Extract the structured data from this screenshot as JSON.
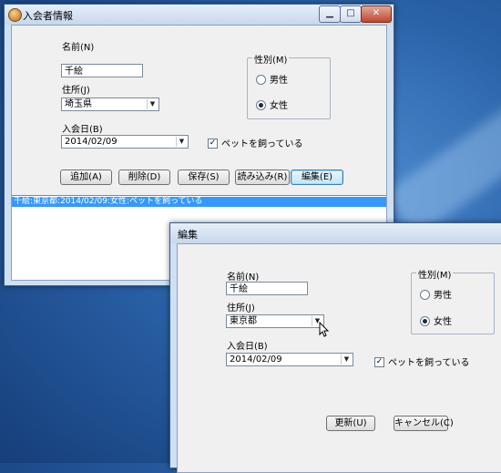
{
  "main_window": {
    "title": "入会者情報",
    "controls": {
      "minimize": "▁",
      "maximize": "□",
      "close": "✕"
    },
    "name_label": "名前(N)",
    "name_value": "千絵",
    "address_label": "住所(J)",
    "address_value": "埼玉県",
    "joined_label": "入会日(B)",
    "joined_value": "2014/02/09",
    "gender_group": "性別(M)",
    "gender_options": [
      "男性",
      "女性"
    ],
    "gender_selected": "女性",
    "pet_label": "ペットを飼っている",
    "pet_checked": "✓",
    "buttons": [
      "追加(A)",
      "削除(D)",
      "保存(S)",
      "読み込み(R)",
      "編集(E)"
    ],
    "list_items": [
      "千絵:東京都:2014/02/09:女性:ペットを飼っている"
    ]
  },
  "edit_window": {
    "title": "編集",
    "name_label": "名前(N)",
    "name_value": "千絵",
    "address_label": "住所(J)",
    "address_value": "東京都",
    "joined_label": "入会日(B)",
    "joined_value": "2014/02/09",
    "gender_group": "性別(M)",
    "gender_options": [
      "男性",
      "女性"
    ],
    "gender_selected": "女性",
    "pet_label": "ペットを飼っている",
    "pet_checked": "✓",
    "update_button": "更新(U)",
    "cancel_button": "キャンセル(C)"
  },
  "colors": {
    "selection": "#3399ff",
    "titlebar": "#c6d8ec",
    "desktop": "#2a62a8"
  },
  "icons": [
    "app-icon",
    "dropdown-arrow-icon",
    "mouse-cursor-icon"
  ]
}
